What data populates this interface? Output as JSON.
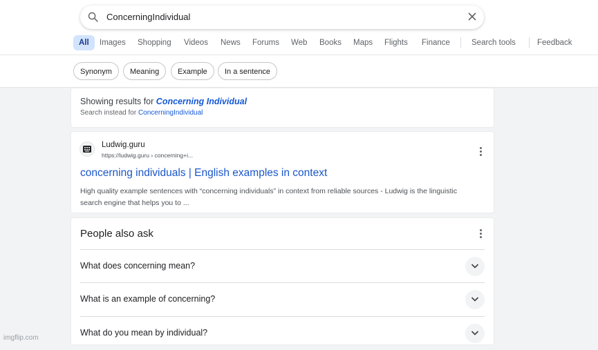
{
  "search": {
    "query": "ConcerningIndividual"
  },
  "tabs": [
    "All",
    "Images",
    "Shopping",
    "Videos",
    "News",
    "Forums",
    "Web",
    "Books",
    "Maps",
    "Flights",
    "Finance"
  ],
  "tools": {
    "search_tools": "Search tools",
    "feedback": "Feedback"
  },
  "chips": [
    "Synonym",
    "Meaning",
    "Example",
    "In a sentence"
  ],
  "correction": {
    "showing_prefix": "Showing results for",
    "corrected_query": "Concerning Individual",
    "instead_prefix": "Search instead for",
    "original_query": "ConcerningIndividual"
  },
  "result": {
    "site_name": "Ludwig.guru",
    "url": "https://ludwig.guru › concerning+i...",
    "title": "concerning individuals | English examples in context",
    "snippet": "High quality example sentences with “concerning individuals” in context from reliable sources - Ludwig is the linguistic search engine that helps you to ..."
  },
  "people_also_ask": {
    "title": "People also ask",
    "questions": [
      "What does concerning mean?",
      "What is an example of concerning?",
      "What do you mean by individual?"
    ]
  },
  "watermark": "imgflip.com",
  "colors": {
    "link": "#1a56c9",
    "active_tab_bg": "#d2e3fc",
    "page_bg": "#f1f3f4"
  }
}
